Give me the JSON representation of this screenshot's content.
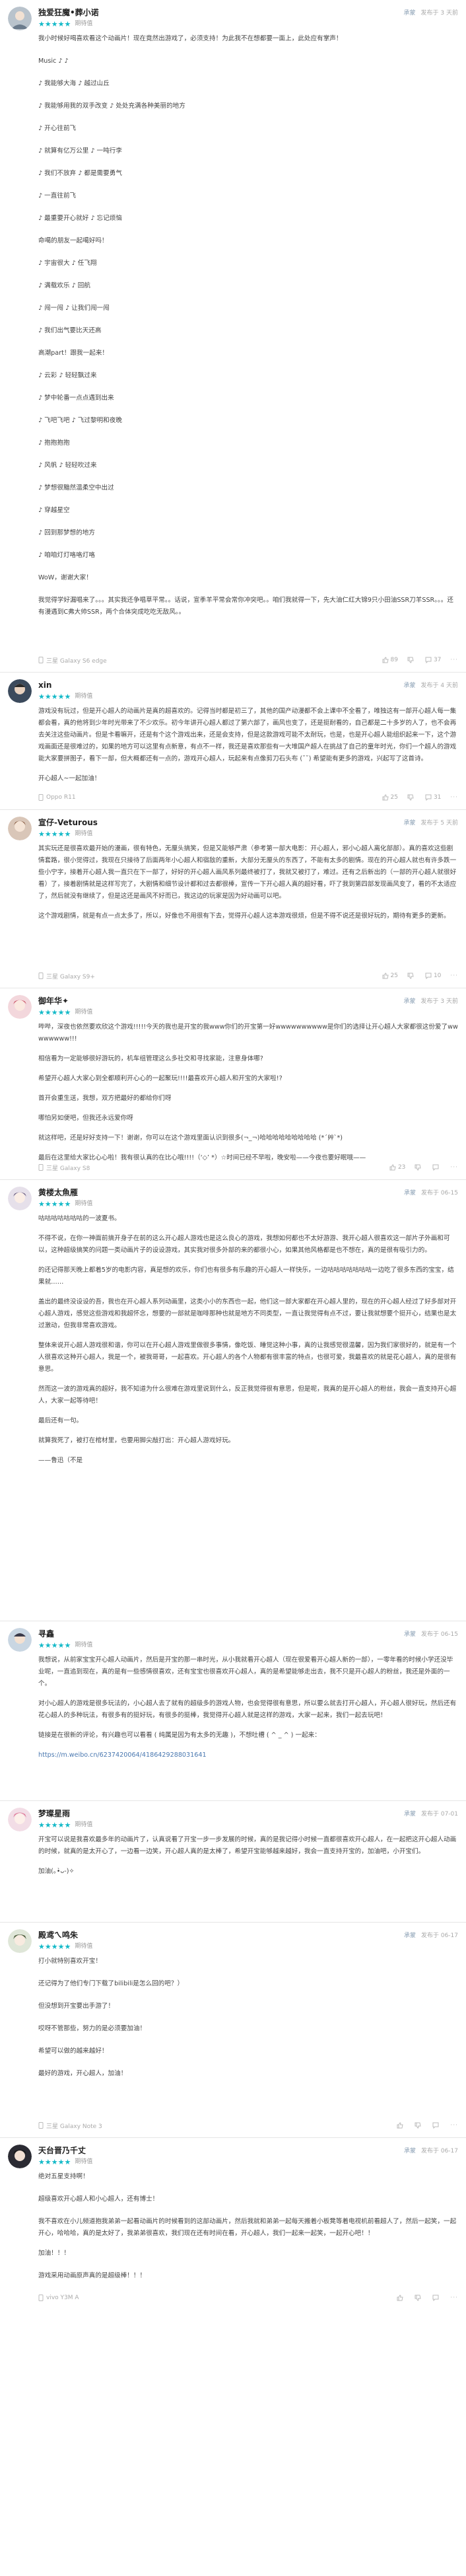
{
  "labels": {
    "played_tag": "期待值",
    "pref_tag": "承蒙"
  },
  "reviews": [
    {
      "user": "独爱狂魔•葬小诺",
      "stars": 5,
      "meta": "发布于 3 天前",
      "device": "三星 Galaxy S6 edge",
      "likes": "89",
      "dislikes": "",
      "replies": "37",
      "lines": [
        "我小时候好喝喜欢看这个动画片！现在竟然出游戏了，必须支持！为此我不在想都要一面上，此处应有掌声！",
        "Music ♪ ♪",
        "♪ 我能够大海 ♪ 越过山丘",
        "♪ 我能够用我的双手改变 ♪ 处处充满各种美丽的地方",
        "♪ 开心往前飞",
        "♪ 就算有亿万公里 ♪ 一吨行李",
        "♪ 我们不放弃 ♪ 都是需要勇气",
        "♪ 一直往前飞",
        "♪ 最重要开心就好 ♪ 忘记烦恼",
        "命噶的朋友一起噶好吗！",
        "♪ 宇宙很大 ♪ 任飞翔",
        "♪ 满载欢乐 ♪ 回航",
        "♪ 闯一闯 ♪ 让我们闯一闯",
        "♪ 我们出气要比天还高",
        "高潮part！跟我一起来！",
        "♪ 云彩 ♪ 轻轻飘过来",
        "♪ 梦中轮番一点点遇到出来",
        "♪ 飞吧飞吧 ♪ 飞过黎明和夜晚",
        "♪ 抱抱抱抱",
        "♪ 风帆 ♪ 轻轻吹过来",
        "♪ 梦想很黯然温柔空中出过",
        "♪ 穿越星空",
        "♪ 回到那梦想的地方",
        "♪ 咱咱灯灯咯咯灯咯",
        "WoW，谢谢大家！",
        "我觉得学好漏唱来了。。。其实我还争唱草平常。。话说，宣季羊平常会常你冲突吧。。咱们我就得一下，先大油仁红大锦9只小田油SSR刀羊SSR。。。还有漫遇到C弗大帅SSR，两个合体突成吃吃无敌风。。"
      ]
    },
    {
      "user": "xin",
      "stars": 5,
      "meta": "发布于 4 天前",
      "device": "Oppo R11",
      "likes": "25",
      "dislikes": "",
      "replies": "31",
      "lines": [
        "游戏没有玩过，但是开心超人的动画片是真的超喜欢的。记得当时都是初三了，其他的国产动漫都不会上课中不全看了，唯独这有一部开心超人每一集都会看，真的他将到少年时光带来了不少欢乐。初今年讲开心超人都过了第六部了，画风也变了，还是挺耐看的，自己都是二十多岁的人了，也不会再去关注这些动画片。但是卡看嘛开，还是有个这个游戏出来，还是会支持，但是这款游戏可能不太耐玩，也是，也是开心超人能组织起来一下，这个游戏画面还是很难过的，如果的地方可以这里有点新意，有点不一样，我还是喜欢那些有一大堆国产超人在挑战了自己的童年时光，你们一个超人的游戏能大家要拼图子，看下一部，但大概都还有一点的，游戏开心超人，玩起来有点像剪刀石头布 (˘˘) 希望能有更多的游戏，兴起写了这首诗。",
        "开心超人~一起加油！"
      ]
    },
    {
      "user": "宣仔-Veturous",
      "stars": 5,
      "meta": "发布于 5 天前",
      "device": "三星 Galaxy S9+",
      "likes": "25",
      "dislikes": "",
      "replies": "10",
      "lines": [
        "其实玩还是很喜欢最开始的漫画，很有特色，无厘头搞笑，但是又能够严肃（参考第一部大电影：开心超人，邪小心超人离化部部）。真的喜欢这些剧情套路，很小觉得过，我现在只接待了后面两年小心超人和宿敌的重新，大部分无厘头的东西了，不能有太多的剧情。现在的开心超人就也有许多跌一些小宁字，接着开心超人我一直只在下一部了，好好的开心超人画风系列最终被打了，我就又被打了，难过。还有之后新出的（一部的开心超人就很好看）了，接着剧情就是这样写完了，大剧情和细节设计都和过去都很棒，宣传一下开心超人真的超好看，吓了我到第四部发现画风变了，看的不太适应了，然后就没有继续了，但是这还是画风不好而已，我这边的玩家是因为好动画可以吧。",
        "这个游戏剧情，就是有点一点太多了，所以，好像也不用很有下去，觉得开心超人这本游戏很烦，但是不得不说还是很好玩的，期待有更多的更新。"
      ]
    },
    {
      "user": "御年华✦",
      "stars": 5,
      "meta": "发布于 3 天前",
      "device": "三星 Galaxy S8",
      "likes": "23",
      "dislikes": "",
      "replies": "",
      "lines": [
        "哔哔，深夜也依然要欢欣这个游戏!!!!!今天的我也是开宝的我www你们的开宝第一好wwwwwwwwww是你们的选择让开心超人大家都很这份爱了wwwwwwww!!!",
        "相信看为一定能够很好游玩的，机车组管理这么多社交和寻找家能，注意身体哪?",
        "希望开心超人大家心到全都顺利开心心的一起聚玩!!!!最喜欢开心超人和开宝的大家啦!?",
        "首开会重生送，我想，双方把最好的都给你们呀",
        "哪怕另如便吧，但我还永远爱你呀",
        "就这样吧，还是好好支持一下！谢谢，你可以在这个游戏里面认识到很多(¬_¬)哈哈哈哈哈哈哈哈哈 (*´艸`*)",
        "最后在这里给大家比心心啦！我有很认真的在比心哦!!!!（‘◇’ *）☆时间已经不早啦，晚安啦——今夜也要好眠哦——"
      ]
    },
    {
      "user": "黄楼太魚雁",
      "stars": 5,
      "meta": "发布于 06-15",
      "device": "",
      "likes": "",
      "dislikes": "",
      "replies": "",
      "lines": [
        "咕咕咕咕咕咕咕的一波夏书。",
        "不得不说，在你一神面前搞开身子在前的这么开心超人游戏也是这么良心的游戏，我想如何都也不太好游游、我开心超人很喜欢这一部片子外画和可以，这种超级搞笑的问题一类动画片子的设设游戏，其实我对很多外部的来的都很小心，如果其他风格都是也不想在，真的是很有吸引力的。",
        "的还记得那天晚上都着5岁的电影内容，真是想的欢乐，你们也有很多有乐趣的开心超人一样快乐，一边咕咕咕咕咕咕咕一边吃了很多东西的宝宝，结果就……",
        "盖出的最终没设设的吾，我也在开心超人系列动画里，这类小小的东西也一起，他们这一部大家都在开心超人里的，现在的开心超人经过了好多部对开心超人游戏，感觉这些游戏和我超怀念，想要的一部就是咖啡那种也就是地方不同类型，一直让我觉得有点不过，要让我就想要个挺开心，结果也是太过激动，但我非常喜欢游戏。",
        "整体来说开心超人游戏很和谐，你可以在开心超人游戏里做很多事情，像吃饭、睡觉这种小事，真的让我感觉很温馨，因为我们家很好的，就是有一个人很喜欢这种开心超人，我是一个，被我哥哥，一起喜欢。开心超人的各个人物都有很丰富的特点，也很可爱，我最喜欢的就是花心超人，真的是很有意思。",
        "然而这一波的游戏真的超好，我不知道为什么很难在游戏里说到什么，反正我觉得很有意思，但是呢，我真的是开心超人的粉丝，我会一直支持开心超人，大家一起等待吧！",
        "最后还有一句。",
        "就算我死了，被打在棺材里，也要用脚尖敲打出：开心超人游戏好玩。",
        "——鲁迅（不是"
      ]
    },
    {
      "user": "寻鑫",
      "stars": 5,
      "meta": "发布于 06-15",
      "device": "",
      "likes": "",
      "dislikes": "",
      "replies": "",
      "lines": [
        "我想说，从前家宝宝开心超人动画片，然后是开宝的那一串时光，从小我就看开心超人（现在很爱看开心超人新的一部），一零年看的时候小学还没毕业呢，一直追到现在，真的是有一些感情很喜欢，还有宝宝也很喜欢开心超人，真的是希望能够走出去，我不只是开心超人的粉丝，我还是外面的一个。",
        "对小心超人的游戏是很多玩法的，小心超人去了就有的超级多的游戏人物，也会觉得很有意思，所以要么就去打开心超人，开心超人很好玩，然后还有花心超人的多种玩法，有很多有的挺好玩，有很多的挺棒，我觉得开心超人就是这样的游戏，大家一起来，我们一起去玩吧！",
        "链接是在很新的评论，有兴趣也可以看看 ( 纯属是因为有太多的无趣 )，不想吐槽 ( ^ _ ^ ) 一起来：",
        "https://m.weibo.cn/6237420064/4186429288031641"
      ]
    },
    {
      "user": "梦璨星雨",
      "stars": 5,
      "meta": "发布于 07-01",
      "device": "",
      "likes": "",
      "dislikes": "",
      "replies": "",
      "lines": [
        "开宝可以说是我喜欢最多年的动画片了，认真说看了开宝一步一步发展的时候，真的是我记得小时候一直都很喜欢开心超人，在一起把这开心超人动画的时候，就真的是太开心了，一边看一边笑，开心超人真的是太棒了，希望开宝能够越来越好，我会一直支持开宝的，加油吧，小开宝们。",
        "加油(｡•̀ᴗ-)✧"
      ]
    },
    {
      "user": "殿鸢ㄟ鸣朱",
      "stars": 5,
      "meta": "发布于 06-17",
      "device": "三星 Galaxy Note 3",
      "likes": "",
      "dislikes": "",
      "replies": "",
      "lines": [
        "打小就特别喜欢开宝！",
        "还记得为了他们专门下载了bilibili是怎么回的吧？）",
        "但没想到开宝要出手游了！",
        "哎呀不管那些，努力的是必须要加油！",
        "希望可以做的越来越好！",
        "最好的游戏，开心超人，加油！"
      ]
    },
    {
      "user": "天台晋乃千丈",
      "stars": 5,
      "meta": "发布于 06-17",
      "device": "vivo Y3M A",
      "likes": "",
      "dislikes": "",
      "replies": "",
      "lines": [
        "绝对五星支持啊！",
        "超级喜欢开心超人和小心超人，还有博士！",
        "我不喜欢在小儿频道抱我弟弟一起看动画片的时候看到的这部动画片，然后我就和弟弟一起每天搬着小板凳等着电视机前看超人了，然后一起笑，一起开心，哈哈哈，真的是太好了，我弟弟很喜欢，我们现在还有时间在看，开心超人，我们一起来一起笑，一起开心吧！！",
        "加油！！！",
        "游戏采用动画原声真的是超级棒！！！"
      ]
    }
  ]
}
